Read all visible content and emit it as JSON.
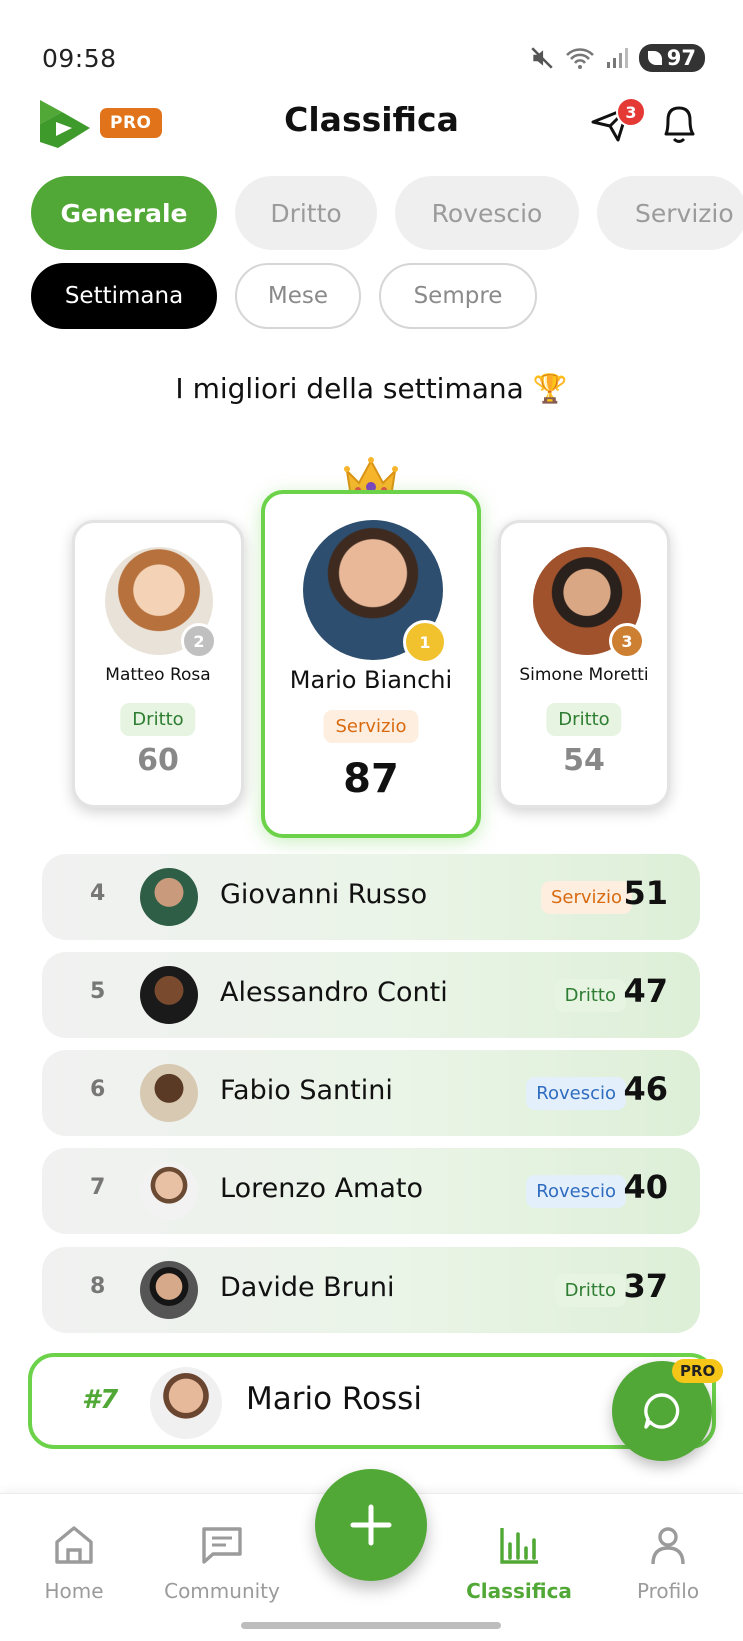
{
  "status": {
    "time": "09:58",
    "battery": "97"
  },
  "header": {
    "pro_label": "PRO",
    "title": "Classifica",
    "messages_badge": "3"
  },
  "tabs": [
    {
      "label": "Generale",
      "active": true
    },
    {
      "label": "Dritto",
      "active": false
    },
    {
      "label": "Rovescio",
      "active": false
    },
    {
      "label": "Servizio",
      "active": false
    }
  ],
  "periods": [
    {
      "label": "Settimana",
      "active": true
    },
    {
      "label": "Mese",
      "active": false
    },
    {
      "label": "Sempre",
      "active": false
    }
  ],
  "subtitle": "I migliori della settimana 🏆",
  "podium": {
    "first": {
      "name": "Mario Bianchi",
      "category": "Servizio",
      "score": "87",
      "medal": "gold-medal-icon"
    },
    "second": {
      "name": "Matteo Rosa",
      "category": "Dritto",
      "score": "60",
      "medal": "silver-medal-icon"
    },
    "third": {
      "name": "Simone Moretti",
      "category": "Dritto",
      "score": "54",
      "medal": "bronze-medal-icon"
    }
  },
  "rows": [
    {
      "rank": "4",
      "name": "Giovanni Russo",
      "category": "Servizio",
      "score": "51"
    },
    {
      "rank": "5",
      "name": "Alessandro Conti",
      "category": "Dritto",
      "score": "47"
    },
    {
      "rank": "6",
      "name": "Fabio Santini",
      "category": "Rovescio",
      "score": "46"
    },
    {
      "rank": "7",
      "name": "Lorenzo Amato",
      "category": "Rovescio",
      "score": "40"
    },
    {
      "rank": "8",
      "name": "Davide Bruni",
      "category": "Dritto",
      "score": "37"
    }
  ],
  "me": {
    "rank": "#7",
    "name": "Mario Rossi"
  },
  "chat": {
    "pro_label": "PRO"
  },
  "nav": {
    "home": "Home",
    "community": "Community",
    "classifica": "Classifica",
    "profilo": "Profilo"
  },
  "colors": {
    "accent": "#52a836",
    "highlight_border": "#6cd24a",
    "pro_orange": "#e1731a"
  }
}
